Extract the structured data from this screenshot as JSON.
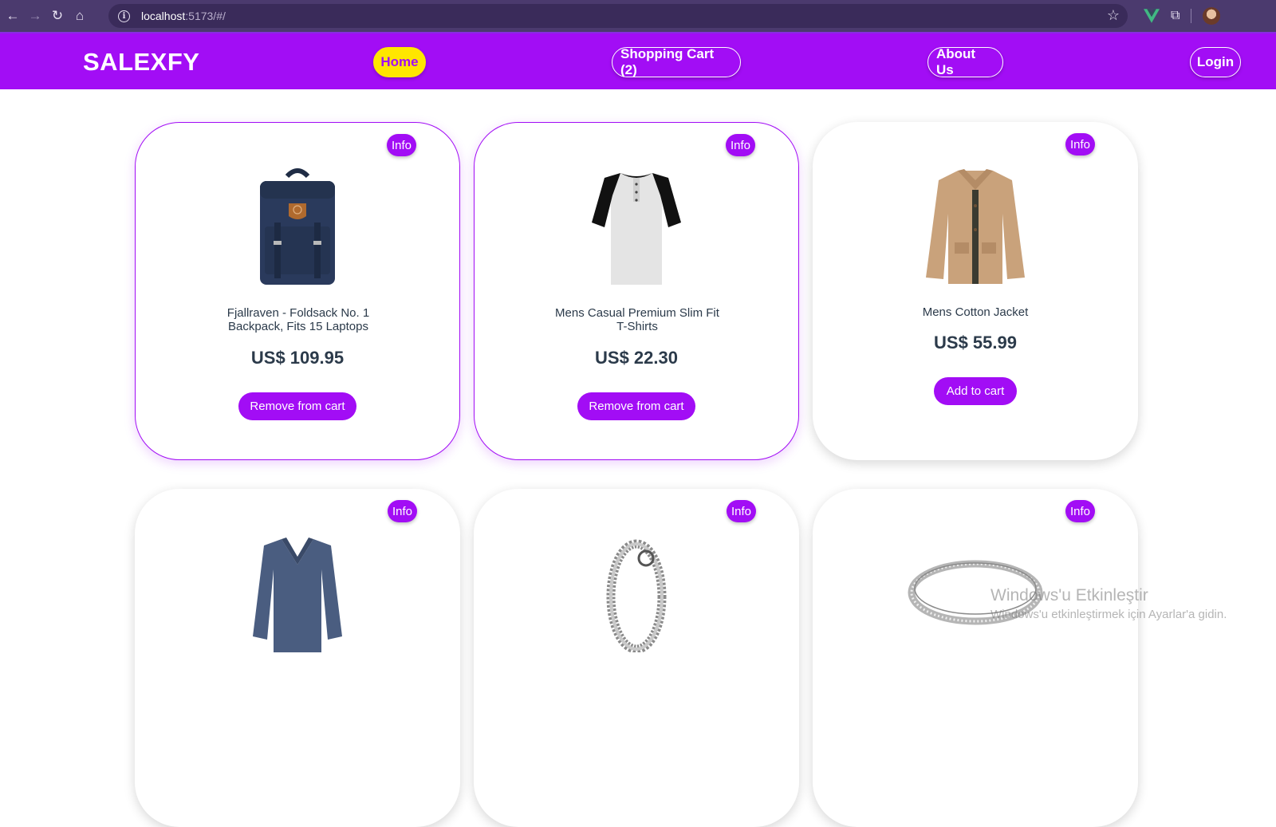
{
  "browser": {
    "url_host": "localhost",
    "url_rest": ":5173/#/",
    "back_icon": "←",
    "forward_icon": "→",
    "reload_icon": "↻",
    "home_icon": "⌂",
    "info_icon": "i",
    "star_icon": "☆",
    "puzzle_icon": "⧉"
  },
  "header": {
    "brand": "SALEXFY",
    "nav": {
      "home": "Home",
      "cart": "Shopping Cart (2)",
      "about": "About Us",
      "login": "Login"
    }
  },
  "colors": {
    "accent": "#a20df5",
    "active_nav": "#ffe600",
    "text_dark": "#2b3a4a"
  },
  "products": [
    {
      "info": "Info",
      "title": "Fjallraven - Foldsack No. 1 Backpack, Fits 15 Laptops",
      "price": "US$ 109.95",
      "action": "Remove from cart",
      "image": "backpack-image"
    },
    {
      "info": "Info",
      "title": "Mens Casual Premium Slim Fit T-Shirts",
      "price": "US$ 22.30",
      "action": "Remove from cart",
      "image": "tshirt-image"
    },
    {
      "info": "Info",
      "title": "Mens Cotton Jacket",
      "price": "US$ 55.99",
      "action": "Add to cart",
      "image": "jacket-image"
    },
    {
      "info": "Info",
      "image": "sweater-image"
    },
    {
      "info": "Info",
      "image": "bracelet-image"
    },
    {
      "info": "Info",
      "image": "ring-image"
    }
  ],
  "watermark": {
    "title": "Windows'u Etkinleştir",
    "subtitle": "Windows'u etkinleştirmek için Ayarlar'a gidin."
  }
}
